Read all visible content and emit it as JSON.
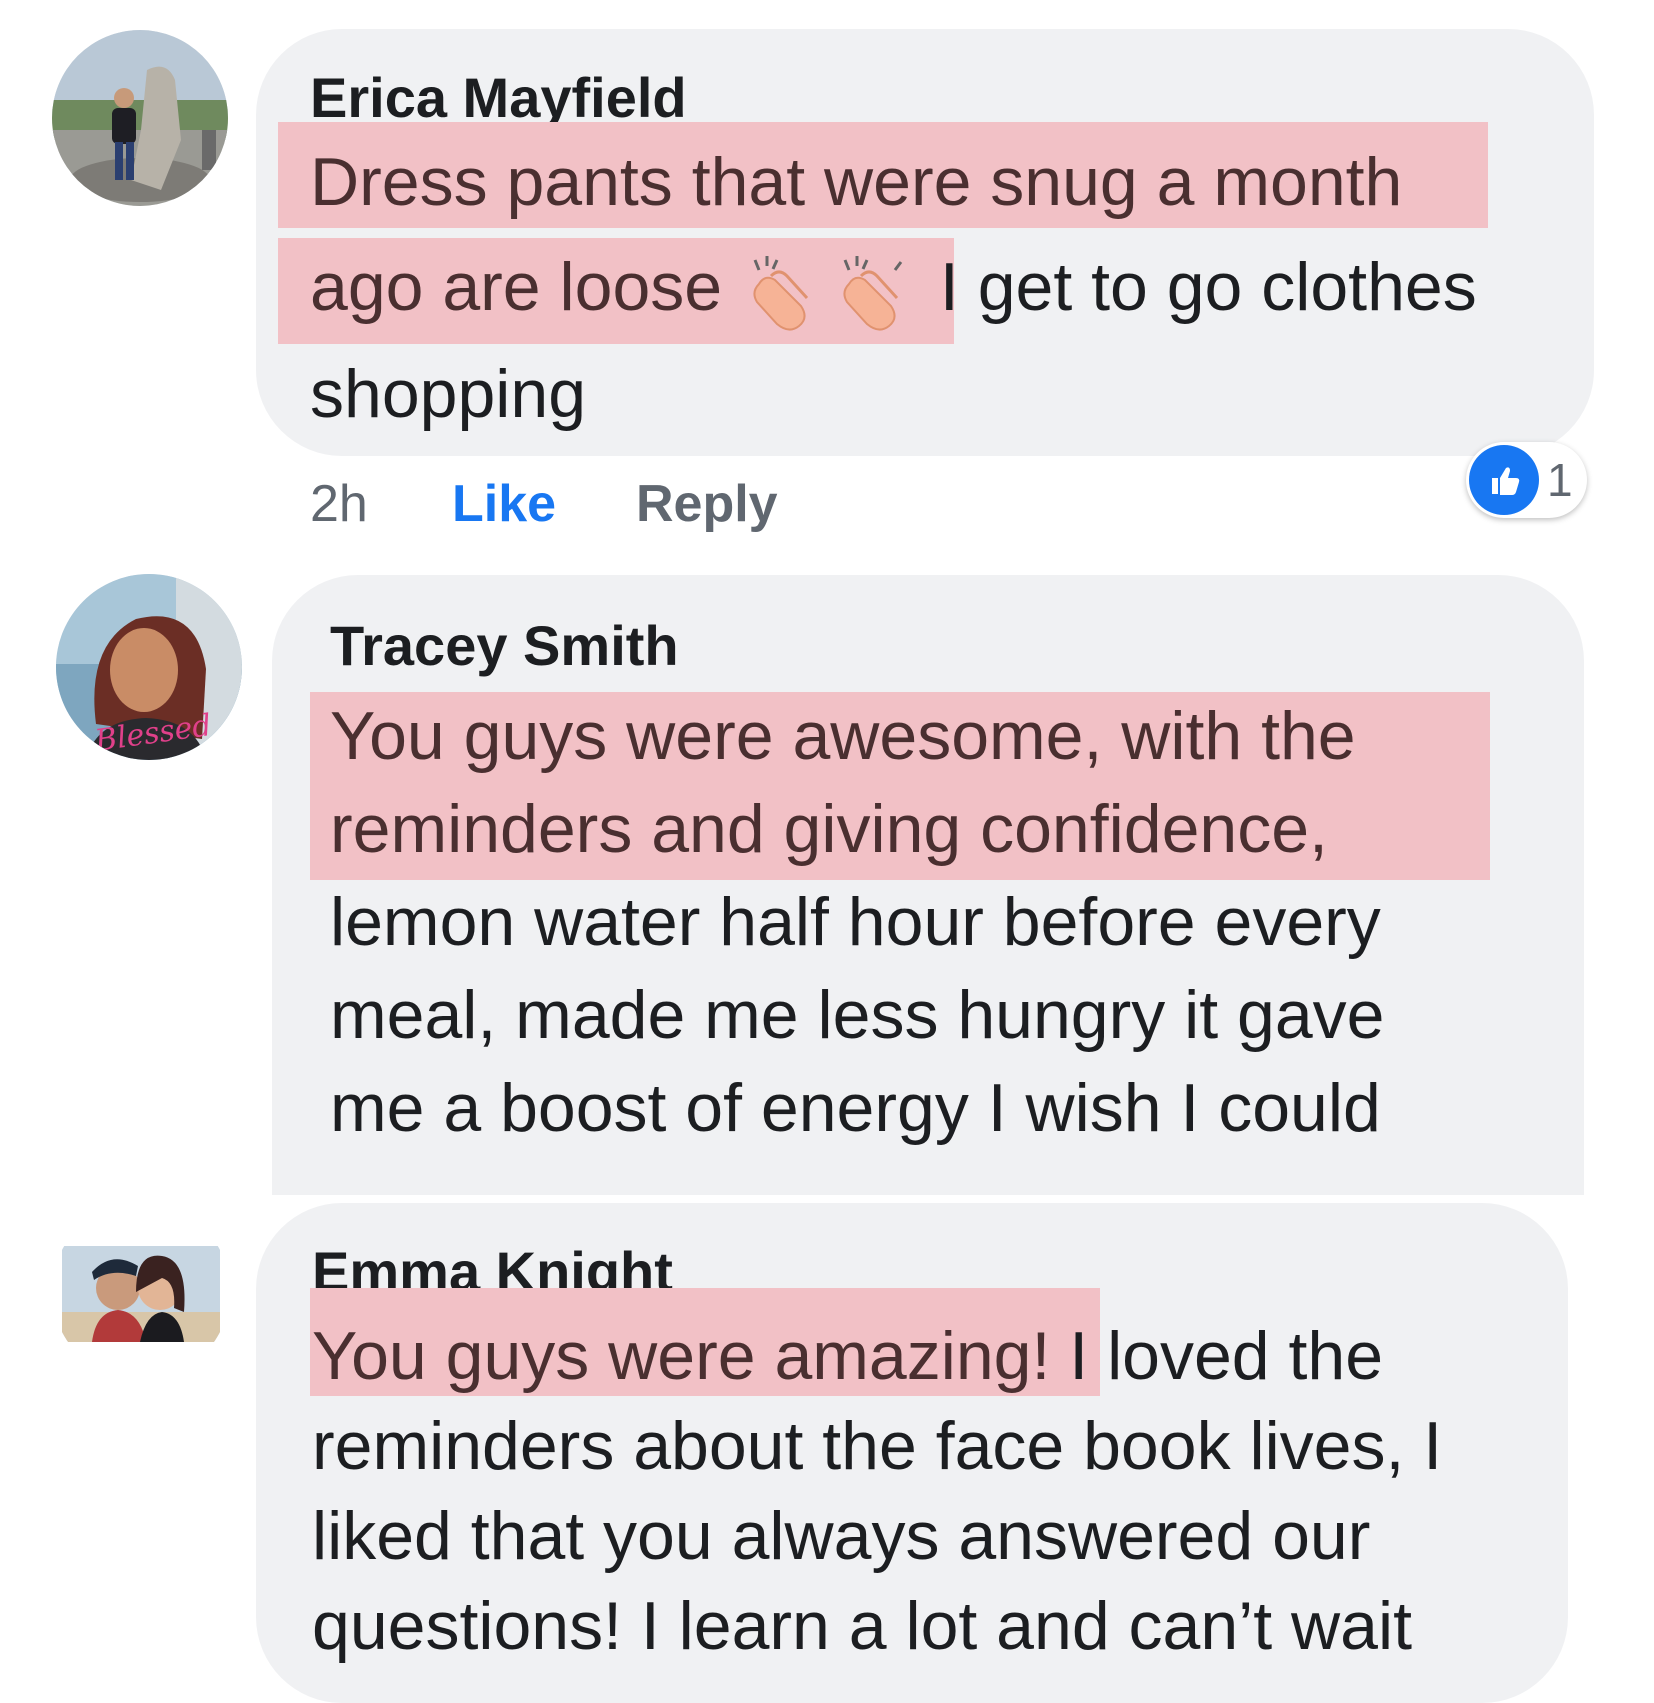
{
  "comments": [
    {
      "author": "Erica Mayfield",
      "lines": {
        "l1": "Dress pants that were snug a month",
        "l2a": "ago are loose",
        "l2b": "I get to go clothes",
        "l3": "shopping"
      },
      "emoji": [
        "clapping-hands-icon",
        "clapping-hands-icon"
      ],
      "time": "2h",
      "like_label": "Like",
      "reply_label": "Reply",
      "reaction_count": "1"
    },
    {
      "author": "Tracey Smith",
      "avatar_overlay_text": "Blessed",
      "lines": {
        "l1": "You guys were awesome, with the",
        "l2": "reminders and giving confidence,",
        "l3": "lemon water half hour before every",
        "l4": "meal, made me less hungry  it gave",
        "l5": "me a boost of energy  I wish I could"
      }
    },
    {
      "author": "Emma Knight",
      "lines": {
        "l1a": "You guys were amazing!",
        "l1b": "I loved the",
        "l2": "reminders about the face book lives, I",
        "l3": "liked that you always answered our",
        "l4": "questions! I learn a lot and can’t wait"
      }
    }
  ],
  "colors": {
    "bubble": "#f0f1f3",
    "highlight": "#f2c1c6",
    "like_blue": "#1877f2",
    "meta_gray": "#606770"
  }
}
